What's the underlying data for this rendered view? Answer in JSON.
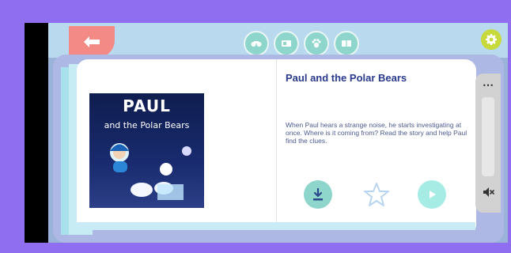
{
  "book": {
    "title": "Paul and the Polar Bears",
    "description": "When Paul hears a strange noise, he starts investigating at once. Where is it coming from? Read the story and help Paul find the clues."
  },
  "cover": {
    "title": "PAUL",
    "subtitle": "and the Polar Bears"
  },
  "toolbar": {
    "icons": [
      "binoculars-icon",
      "video-icon",
      "paw-icon",
      "book-icon"
    ]
  },
  "colors": {
    "background": "#8f6ef0",
    "accent_teal": "#8ed6cb",
    "back_button": "#f38a86",
    "settings_button": "#c7d93b",
    "title": "#2a3a8c"
  },
  "side_panel": {
    "menu_icon": "more-icon",
    "mute_icon": "mute-icon"
  }
}
